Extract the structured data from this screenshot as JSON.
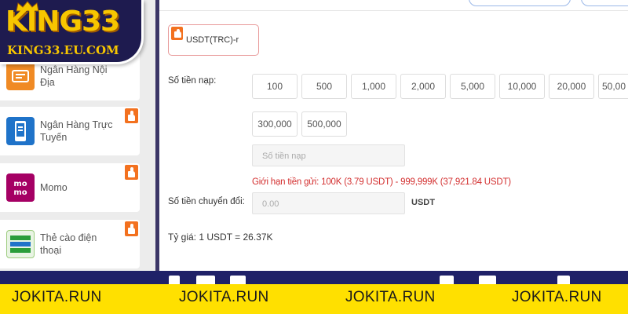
{
  "brand": {
    "name": "KING33",
    "url": "KING33.EU.COM",
    "color": "#f7c600"
  },
  "sidebar": {
    "items": [
      {
        "label": "Ngân Hàng Nội Địa",
        "icon": "bank-transfer-icon",
        "hot": false
      },
      {
        "label": "Ngân Hàng Trực Tuyến",
        "icon": "mobile-banking-icon",
        "hot": true
      },
      {
        "label": "Momo",
        "icon": "momo-icon",
        "hot": true
      },
      {
        "label": "Thẻ cào điện thoại",
        "icon": "phone-card-icon",
        "hot": true
      }
    ]
  },
  "payment": {
    "method": "USDT(TRC)-r",
    "amount_label": "Số tiền nạp:",
    "amounts": [
      "100",
      "500",
      "1,000",
      "2,000",
      "5,000",
      "10,000",
      "20,000",
      "50,00",
      "300,000",
      "500,000"
    ],
    "amount_placeholder": "Số tiền nạp",
    "limit_text": "Giới hạn tiền gửi:  100K (3.79 USDT) - 999,999K (37,921.84 USDT)",
    "convert_label": "Số tiền chuyển đổi:",
    "convert_value": "0.00",
    "convert_unit": "USDT",
    "rate_text": "Tỷ giá:  1  USDT  =  26.37K"
  },
  "watermark": {
    "text": "JOKITA.RUN",
    "repeat": 4
  },
  "colors": {
    "accent_red": "#d32f2f",
    "hot_badge": "#f3711f",
    "banner_yellow": "#ffe000",
    "banner_navy": "#1f2168"
  }
}
